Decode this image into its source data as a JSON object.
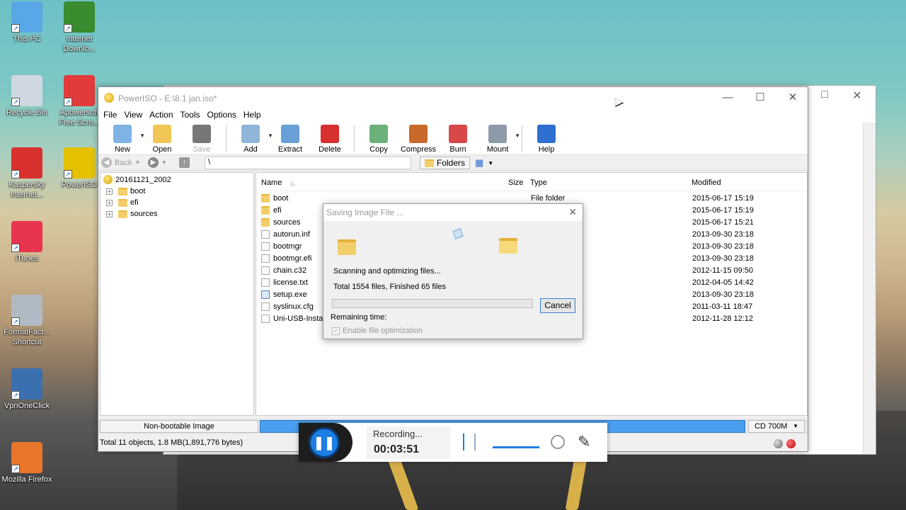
{
  "desktop": {
    "icons": [
      {
        "label": "This PC",
        "icon": "this-pc-icon",
        "color": "#5aa7e8"
      },
      {
        "label": "Internet Downlo...",
        "icon": "internet-download-manager-icon",
        "color": "#3b8b2f"
      },
      {
        "label": "Recycle Bin",
        "icon": "recycle-bin-icon",
        "color": "#cfd8e0"
      },
      {
        "label": "Apowersoft Free Scre...",
        "icon": "apowersoft-recorder-icon",
        "color": "#e23b3b"
      },
      {
        "label": "Kaspersky Internet...",
        "icon": "kaspersky-icon",
        "color": "#d9312e"
      },
      {
        "label": "PowerISO",
        "icon": "poweriso-icon",
        "color": "#e5c200"
      },
      {
        "label": "iTunes",
        "icon": "itunes-icon",
        "color": "#e8344f"
      },
      {
        "label": "FormatFact... Shortcut",
        "icon": "format-factory-icon",
        "color": "#b0bac4"
      },
      {
        "label": "VpnOneClick",
        "icon": "vpn-icon",
        "color": "#3a6fb0"
      },
      {
        "label": "Mozilla Firefox",
        "icon": "firefox-icon",
        "color": "#e8762b"
      }
    ]
  },
  "window": {
    "title": "PowerISO - E:\\8.1 jan.iso*",
    "menu": [
      "File",
      "View",
      "Action",
      "Tools",
      "Options",
      "Help"
    ],
    "toolbar": [
      {
        "label": "New",
        "icon": "new-icon",
        "color": "#7fb2e5",
        "dropdown": true,
        "enabled": true
      },
      {
        "label": "Open",
        "icon": "open-icon",
        "color": "#f1c654",
        "dropdown": false,
        "enabled": true
      },
      {
        "label": "Save",
        "icon": "save-icon",
        "color": "#555555",
        "dropdown": false,
        "enabled": false
      },
      {
        "label": "Add",
        "icon": "add-icon",
        "color": "#8fb6d9",
        "dropdown": true,
        "enabled": true
      },
      {
        "label": "Extract",
        "icon": "extract-icon",
        "color": "#6aa0d8",
        "dropdown": false,
        "enabled": true
      },
      {
        "label": "Delete",
        "icon": "delete-icon",
        "color": "#d83030",
        "dropdown": false,
        "enabled": true
      },
      {
        "label": "Copy",
        "icon": "copy-icon",
        "color": "#6cb07a",
        "dropdown": false,
        "enabled": true
      },
      {
        "label": "Compress",
        "icon": "compress-icon",
        "color": "#c9692c",
        "dropdown": false,
        "enabled": true
      },
      {
        "label": "Burn",
        "icon": "burn-icon",
        "color": "#d84848",
        "dropdown": false,
        "enabled": true
      },
      {
        "label": "Mount",
        "icon": "mount-icon",
        "color": "#8d9aa8",
        "dropdown": true,
        "enabled": true
      },
      {
        "label": "Help",
        "icon": "help-icon",
        "color": "#2e6fd0",
        "dropdown": false,
        "enabled": true
      }
    ],
    "nav": {
      "back": "Back",
      "path": "\\",
      "folders": "Folders"
    },
    "tree": {
      "root": "20161121_2002",
      "children": [
        "boot",
        "efi",
        "sources"
      ]
    },
    "columns": [
      "Name",
      "Size",
      "Type",
      "Modified"
    ],
    "files": [
      {
        "name": "boot",
        "size": "",
        "type": "File folder",
        "modified": "2015-06-17 15:19",
        "kind": "folder"
      },
      {
        "name": "efi",
        "size": "",
        "type": "",
        "modified": "2015-06-17 15:19",
        "kind": "folder"
      },
      {
        "name": "sources",
        "size": "",
        "type": "",
        "modified": "2015-06-17 15:21",
        "kind": "folder"
      },
      {
        "name": "autorun.inf",
        "size": "",
        "type": "on",
        "modified": "2013-09-30 23:18",
        "kind": "file"
      },
      {
        "name": "bootmgr",
        "size": "",
        "type": "",
        "modified": "2013-09-30 23:18",
        "kind": "file"
      },
      {
        "name": "bootmgr.efi",
        "size": "",
        "type": "",
        "modified": "2013-09-30 23:18",
        "kind": "file"
      },
      {
        "name": "chain.c32",
        "size": "",
        "type": "",
        "modified": "2012-11-15 09:50",
        "kind": "file"
      },
      {
        "name": "license.txt",
        "size": "",
        "type": "",
        "modified": "2012-04-05 14:42",
        "kind": "file"
      },
      {
        "name": "setup.exe",
        "size": "",
        "type": "",
        "modified": "2013-09-30 23:18",
        "kind": "exe"
      },
      {
        "name": "syslinux.cfg",
        "size": "",
        "type": "",
        "modified": "2011-03-11 18:47",
        "kind": "file"
      },
      {
        "name": "Uni-USB-Install",
        "size": "",
        "type": "",
        "modified": "2012-11-28 12:12",
        "kind": "file"
      }
    ],
    "status": {
      "boot": "Non-bootable Image",
      "media": "CD 700M",
      "summary": "Total 11 objects, 1.8 MB(1,891,776 bytes)"
    }
  },
  "dialog": {
    "title": "Saving Image File ...",
    "line1": "Scanning and optimizing files...",
    "line2": "Total 1554 files, Finished 65 files",
    "progress": 0,
    "remaining": "Remaining time:",
    "cancel": "Cancel",
    "checkbox": "Enable file optimization"
  },
  "recorder": {
    "status": "Recording...",
    "time": "00:03:51"
  }
}
